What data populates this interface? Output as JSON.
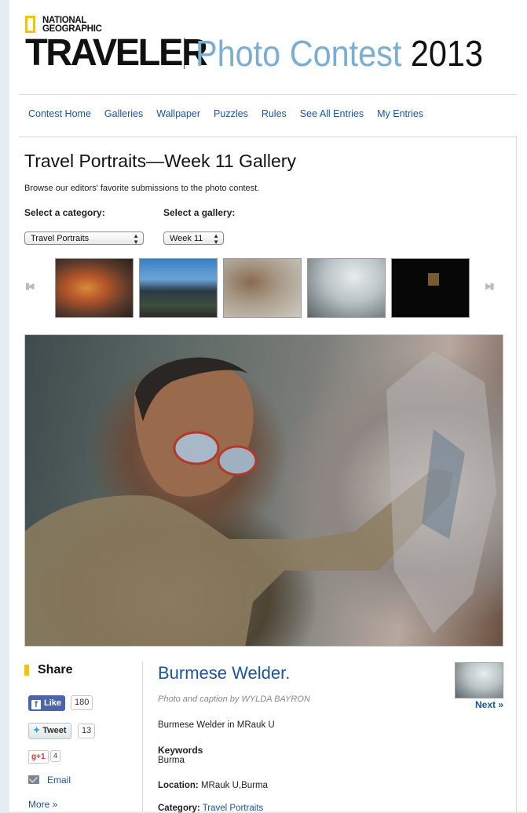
{
  "brand": {
    "ng_line1": "NATIONAL",
    "ng_line2": "GEOGRAPHIC",
    "traveler": "TRAVELER",
    "contest_title": "Photo Contest",
    "contest_year": "2013",
    "accent_color": "#f5c400",
    "title_color": "#7aaed2"
  },
  "nav": {
    "items": [
      "Contest Home",
      "Galleries",
      "Wallpaper",
      "Puzzles",
      "Rules",
      "See All Entries",
      "My Entries"
    ]
  },
  "gallery": {
    "title": "Travel Portraits—Week 11 Gallery",
    "description": "Browse our editors' favorite submissions to the photo contest.",
    "category_label": "Select a category:",
    "category_value": "Travel Portraits",
    "gallery_label": "Select a gallery:",
    "gallery_value": "Week 11"
  },
  "filmstrip": {
    "prev_icon": "▮◀",
    "next_icon": "▶▮",
    "thumbnails": [
      "thumb-1",
      "thumb-2",
      "thumb-3",
      "thumb-4",
      "thumb-5"
    ]
  },
  "share": {
    "title": "Share",
    "like_label": "Like",
    "like_count": "180",
    "tweet_label": "Tweet",
    "tweet_count": "13",
    "gplus_label": "g+1",
    "gplus_count": "4",
    "email_label": "Email",
    "more_label": "More »"
  },
  "photo": {
    "title": "Burmese Welder.",
    "credit": "Photo and caption by WYLDA BAYRON",
    "caption": "Burmese Welder in MRauk U",
    "keywords_label": "Keywords",
    "keywords_value": "Burma",
    "location_label": "Location:",
    "location_value": "MRauk U,Burma",
    "category_label": "Category:",
    "category_value": "Travel Portraits",
    "next_label": "Next »"
  }
}
